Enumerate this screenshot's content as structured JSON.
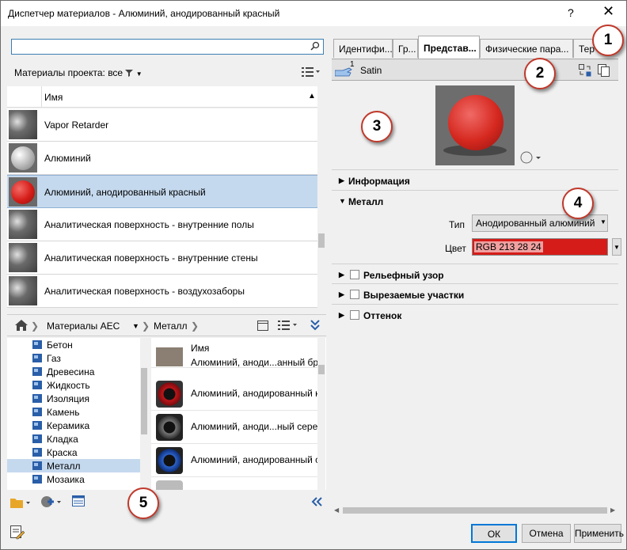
{
  "window": {
    "title": "Диспетчер материалов - Алюминий, анодированный красный",
    "help": "?",
    "close": "✕"
  },
  "browser": {
    "search_placeholder": "",
    "filter_label": "Материалы проекта: все",
    "column_name": "Имя",
    "materials": [
      {
        "name": "Vapor Retarder",
        "thumb": "gray-cylinder",
        "selected": false
      },
      {
        "name": "Алюминий",
        "thumb": "silver-sphere",
        "selected": false
      },
      {
        "name": "Алюминий, анодированный красный",
        "thumb": "red-sphere",
        "selected": true
      },
      {
        "name": "Аналитическая поверхность - внутренние полы",
        "thumb": "gray-cylinder",
        "selected": false
      },
      {
        "name": "Аналитическая поверхность - внутренние стены",
        "thumb": "gray-cylinder",
        "selected": false
      },
      {
        "name": "Аналитическая поверхность - воздухозаборы",
        "thumb": "gray-cylinder",
        "selected": false
      }
    ]
  },
  "library": {
    "breadcrumb": [
      "Материалы AEC",
      "Металл"
    ],
    "categories": [
      "Бетон",
      "Газ",
      "Древесина",
      "Жидкость",
      "Изоляция",
      "Камень",
      "Керамика",
      "Кладка",
      "Краска",
      "Металл",
      "Мозаика"
    ],
    "selected_category": "Металл",
    "assets_header": "Имя",
    "assets": [
      {
        "name": "Алюминий, аноди...анный бр",
        "color": "#8a7f72"
      },
      {
        "name": "Алюминий, анодированный к",
        "color": "#c0161a"
      },
      {
        "name": "Алюминий, аноди...ный сере",
        "color": "#555555"
      },
      {
        "name": "Алюминий, анодированный с",
        "color": "#1d4fb0"
      }
    ]
  },
  "editor": {
    "tabs": [
      "Идентифи...",
      "Гр...",
      "Представ...",
      "Физические пара...",
      "Тер"
    ],
    "active_tab": 2,
    "asset_name": "Satin",
    "asset_count": "1",
    "sections": {
      "info": "Информация",
      "metal": "Металл",
      "relief": "Рельефный узор",
      "cutouts": "Вырезаемые участки",
      "tint": "Оттенок"
    },
    "type_label": "Тип",
    "type_value": "Анодированный алюминий",
    "color_label": "Цвет",
    "color_value": "RGB 213 28 24",
    "color_hex": "#d51c18"
  },
  "buttons": {
    "ok": "ОК",
    "cancel": "Отмена",
    "apply": "Применить"
  },
  "callouts": [
    "1",
    "2",
    "3",
    "4",
    "5"
  ]
}
